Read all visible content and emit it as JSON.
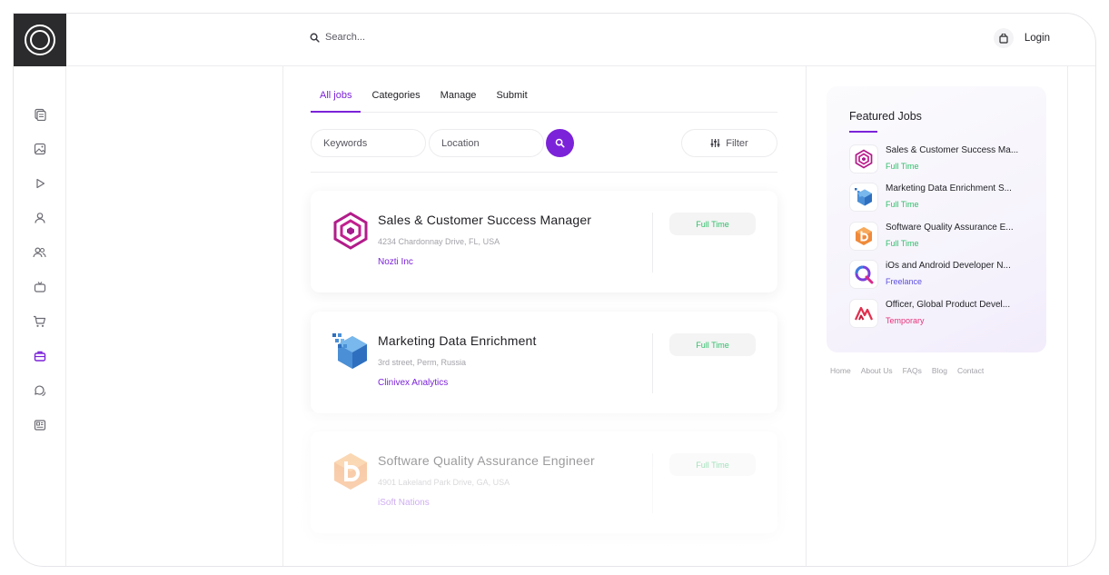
{
  "search": {
    "placeholder": "Search..."
  },
  "header": {
    "login_label": "Login"
  },
  "sidebar": {
    "items": [
      {
        "icon": "document-icon",
        "active": false
      },
      {
        "icon": "image-icon",
        "active": false
      },
      {
        "icon": "play-icon",
        "active": false
      },
      {
        "icon": "user-icon",
        "active": false
      },
      {
        "icon": "users-icon",
        "active": false
      },
      {
        "icon": "tv-icon",
        "active": false
      },
      {
        "icon": "cart-icon",
        "active": false
      },
      {
        "icon": "briefcase-icon",
        "active": true
      },
      {
        "icon": "chat-icon",
        "active": false
      },
      {
        "icon": "news-icon",
        "active": false
      }
    ]
  },
  "tabs": [
    {
      "label": "All jobs",
      "active": true
    },
    {
      "label": "Categories",
      "active": false
    },
    {
      "label": "Manage",
      "active": false
    },
    {
      "label": "Submit",
      "active": false
    }
  ],
  "filters": {
    "keywords_placeholder": "Keywords",
    "location_placeholder": "Location",
    "filter_label": "Filter"
  },
  "jobs": [
    {
      "title": "Sales & Customer Success Manager",
      "address": "4234 Chardonnay Drive, FL, USA",
      "company": "Nozti Inc",
      "type": "Full Time",
      "logo": "nozti-logo-icon"
    },
    {
      "title": "Marketing Data Enrichment",
      "address": "3rd street, Perm, Russia",
      "company": "Clinivex Analytics",
      "type": "Full Time",
      "logo": "clinivex-logo-icon"
    },
    {
      "title": "Software Quality Assurance Engineer",
      "address": "4901 Lakeland Park Drive, GA, USA",
      "company": "iSoft Nations",
      "type": "Full Time",
      "logo": "isoft-logo-icon"
    }
  ],
  "featured": {
    "title": "Featured Jobs",
    "items": [
      {
        "title": "Sales & Customer Success Ma...",
        "type": "Full Time",
        "type_color": "#2fbf6a"
      },
      {
        "title": "Marketing Data Enrichment S...",
        "type": "Full Time",
        "type_color": "#2fbf6a"
      },
      {
        "title": "Software Quality Assurance E...",
        "type": "Full Time",
        "type_color": "#2fbf6a"
      },
      {
        "title": "iOs and Android Developer N...",
        "type": "Freelance",
        "type_color": "#5b4ee0"
      },
      {
        "title": "Officer, Global Product Devel...",
        "type": "Temporary",
        "type_color": "#e6337a"
      }
    ]
  },
  "footer": {
    "links": [
      "Home",
      "About Us",
      "FAQs",
      "Blog",
      "Contact"
    ]
  },
  "colors": {
    "accent": "#7b23d9",
    "success": "#2fbf6a"
  }
}
